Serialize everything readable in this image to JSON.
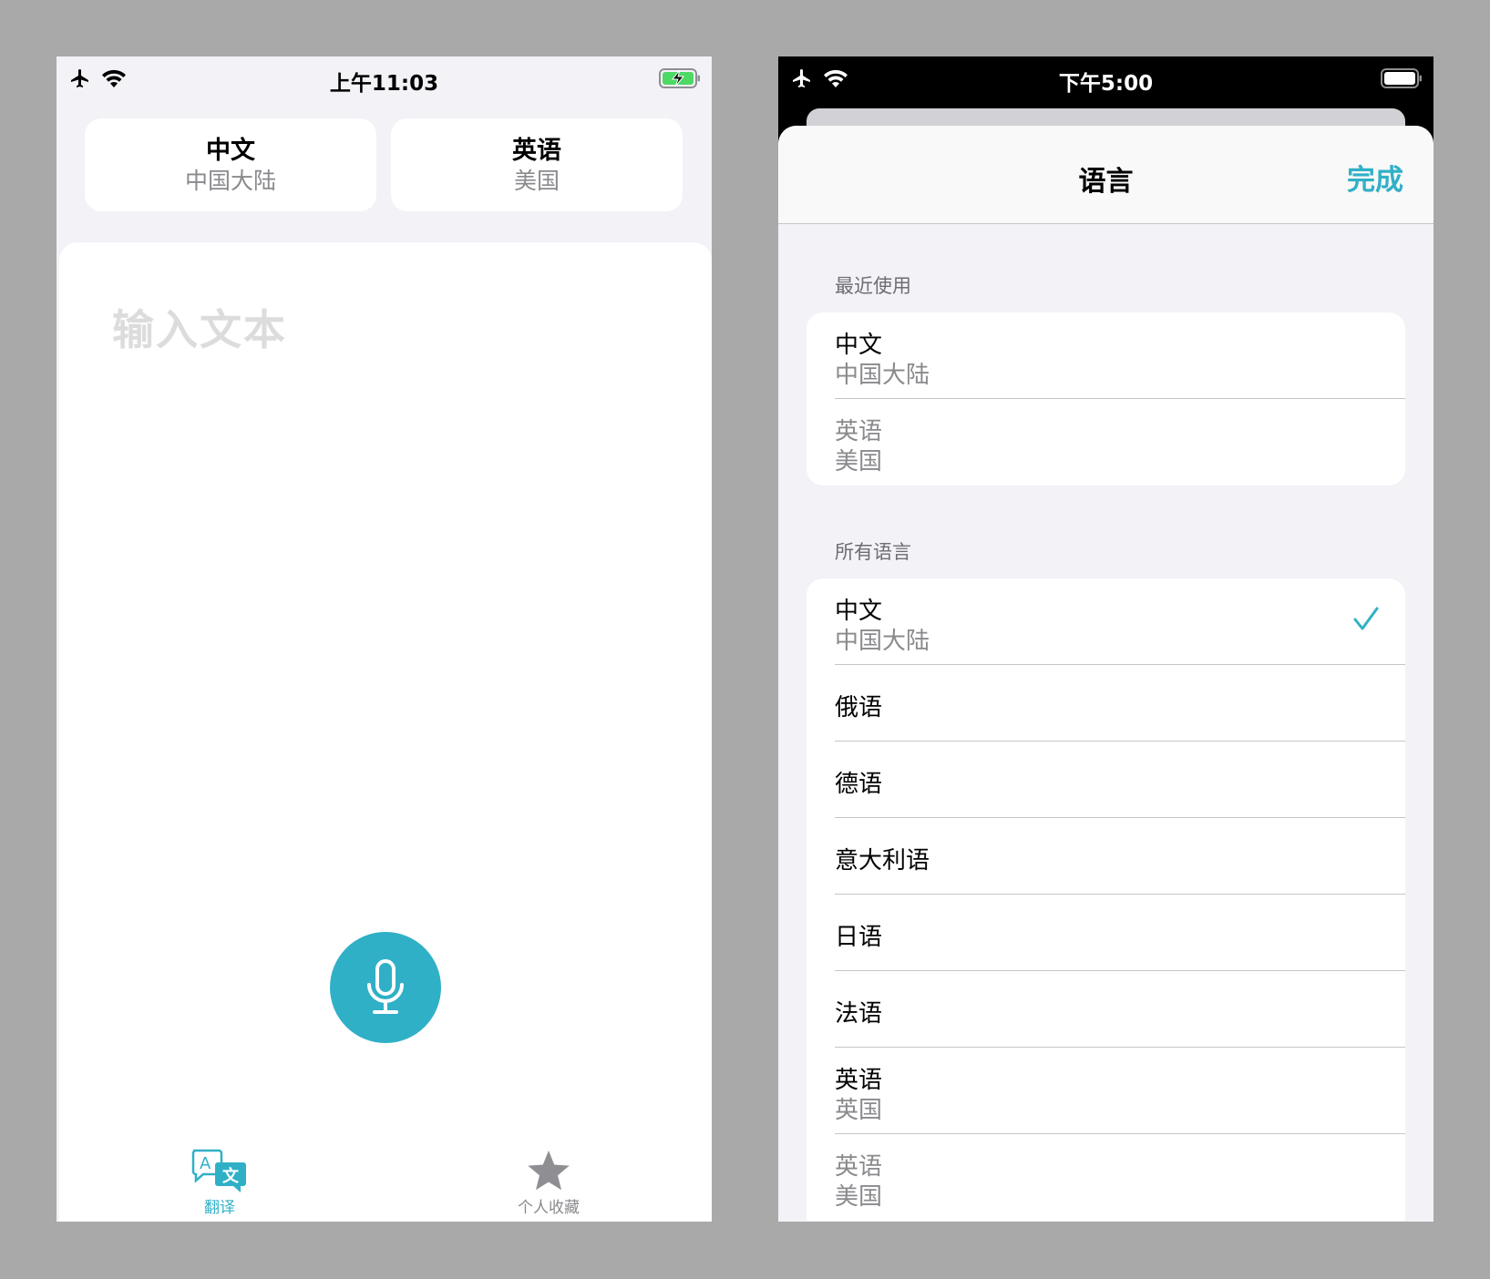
{
  "left_screen": {
    "status": {
      "time": "上午11:03"
    },
    "source_lang": {
      "name": "中文",
      "region": "中国大陆"
    },
    "target_lang": {
      "name": "英语",
      "region": "美国"
    },
    "input_placeholder": "输入文本",
    "tabs": [
      {
        "label": "翻译",
        "icon": "translate-icon",
        "active": true
      },
      {
        "label": "个人收藏",
        "icon": "star-icon",
        "active": false
      }
    ]
  },
  "right_screen": {
    "status": {
      "time": "下午5:00"
    },
    "title": "语言",
    "done_label": "完成",
    "recent_header": "最近使用",
    "recent": [
      {
        "name": "中文",
        "region": "中国大陆"
      },
      {
        "name": "英语",
        "region": "美国"
      }
    ],
    "all_header": "所有语言",
    "all": [
      {
        "name": "中文",
        "region": "中国大陆",
        "selected": true
      },
      {
        "name": "俄语"
      },
      {
        "name": "德语"
      },
      {
        "name": "意大利语"
      },
      {
        "name": "日语"
      },
      {
        "name": "法语"
      },
      {
        "name": "英语",
        "region": "英国"
      },
      {
        "name": "英语",
        "region": "美国"
      }
    ]
  },
  "colors": {
    "accent": "#30b0c7",
    "background": "#f2f2f7",
    "secondary_text": "#8a8a8e",
    "battery_charging": "#4cd964"
  }
}
